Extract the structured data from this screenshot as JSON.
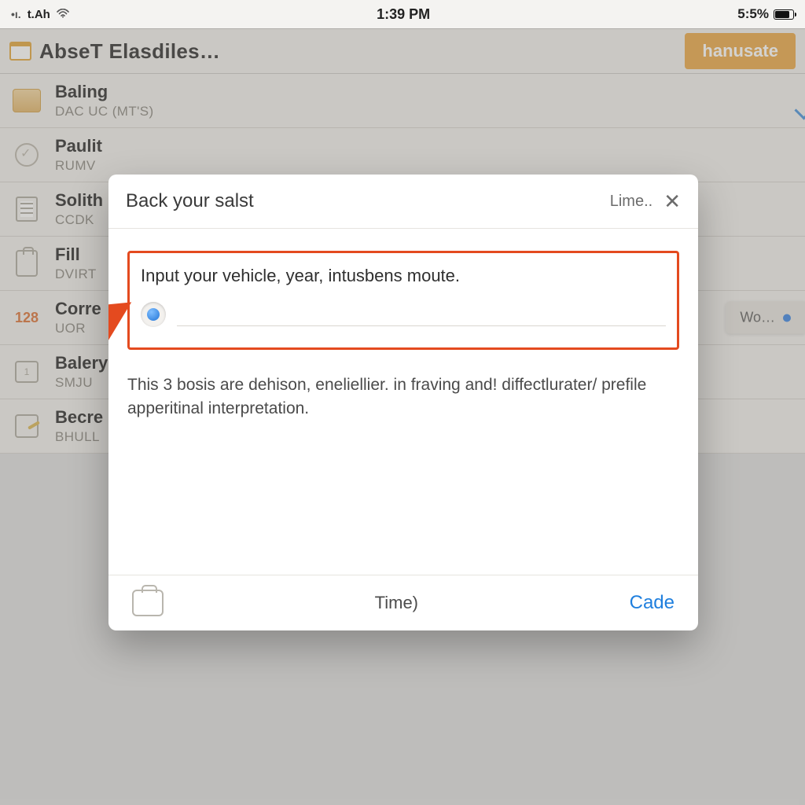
{
  "status": {
    "left_label": "t.Ah",
    "time": "1:39 PM",
    "battery_text": "5:5%"
  },
  "header": {
    "title": "AbseT Elasdiles…",
    "cta_label": "hanusate"
  },
  "rows": [
    {
      "title": "Baling",
      "sub": "DAC Uc  (MT'S)"
    },
    {
      "title": "Paulit",
      "sub": "Rumv"
    },
    {
      "title": "Solith",
      "sub": "CCDK"
    },
    {
      "title": "Fill",
      "sub": "DVIRT"
    },
    {
      "title": "Corre",
      "sub": "UOR"
    },
    {
      "title": "Balery",
      "sub": "SMJU"
    },
    {
      "title": "Becre",
      "sub": "Bhull"
    }
  ],
  "row4_badge": "128",
  "side_pill": "Wo…",
  "cal_badge": "1",
  "modal": {
    "title": "Back your salst",
    "lime_label": "Lime..",
    "prompt": "Input your vehicle, year, intusbens moute.",
    "explain": "This 3 bosis are dehison, eneliellier. in fraving and! diffectlurater/ prefile apperitinal interpretation.",
    "footer_time": "Time)",
    "footer_cade": "Cade"
  }
}
